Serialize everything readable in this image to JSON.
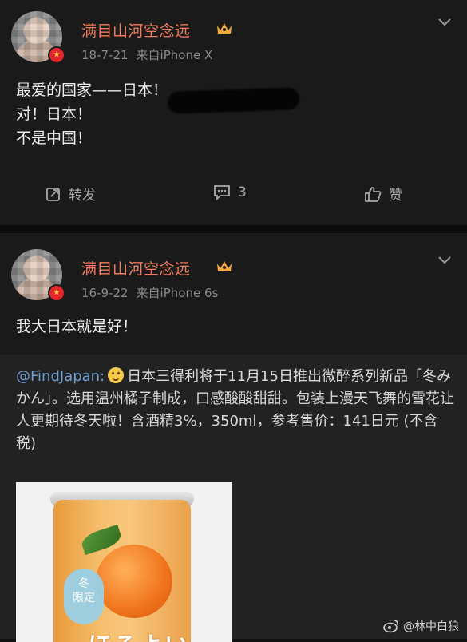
{
  "posts": [
    {
      "username": "满目山河空念远",
      "date": "18-7-21",
      "source": "来自iPhone X",
      "lines": [
        "最爱的国家——日本！",
        "对！日本！",
        "不是中国！"
      ],
      "actions": {
        "repost": "转发",
        "comment": "3",
        "like": "赞"
      }
    },
    {
      "username": "满目山河空念远",
      "date": "16-9-22",
      "source": "来自iPhone 6s",
      "lines": [
        "我大日本就是好！"
      ],
      "repost": {
        "mention": "@FindJapan:",
        "text": "日本三得利将于11月15日推出微醉系列新品「冬みかん」。选用温州橘子制成，口感酸酸甜甜。包装上漫天飞舞的雪花让人更期待冬天啦！含酒精3%，350ml，参考售价：141日元 (不含税)",
        "image_text": {
          "label": "冬\n限定",
          "brand": "ほろよい"
        }
      }
    }
  ],
  "watermark": "@林中白狼",
  "colors": {
    "username": "#f27c5e",
    "mention": "#6f9fd3",
    "badge": "#e3262c"
  }
}
